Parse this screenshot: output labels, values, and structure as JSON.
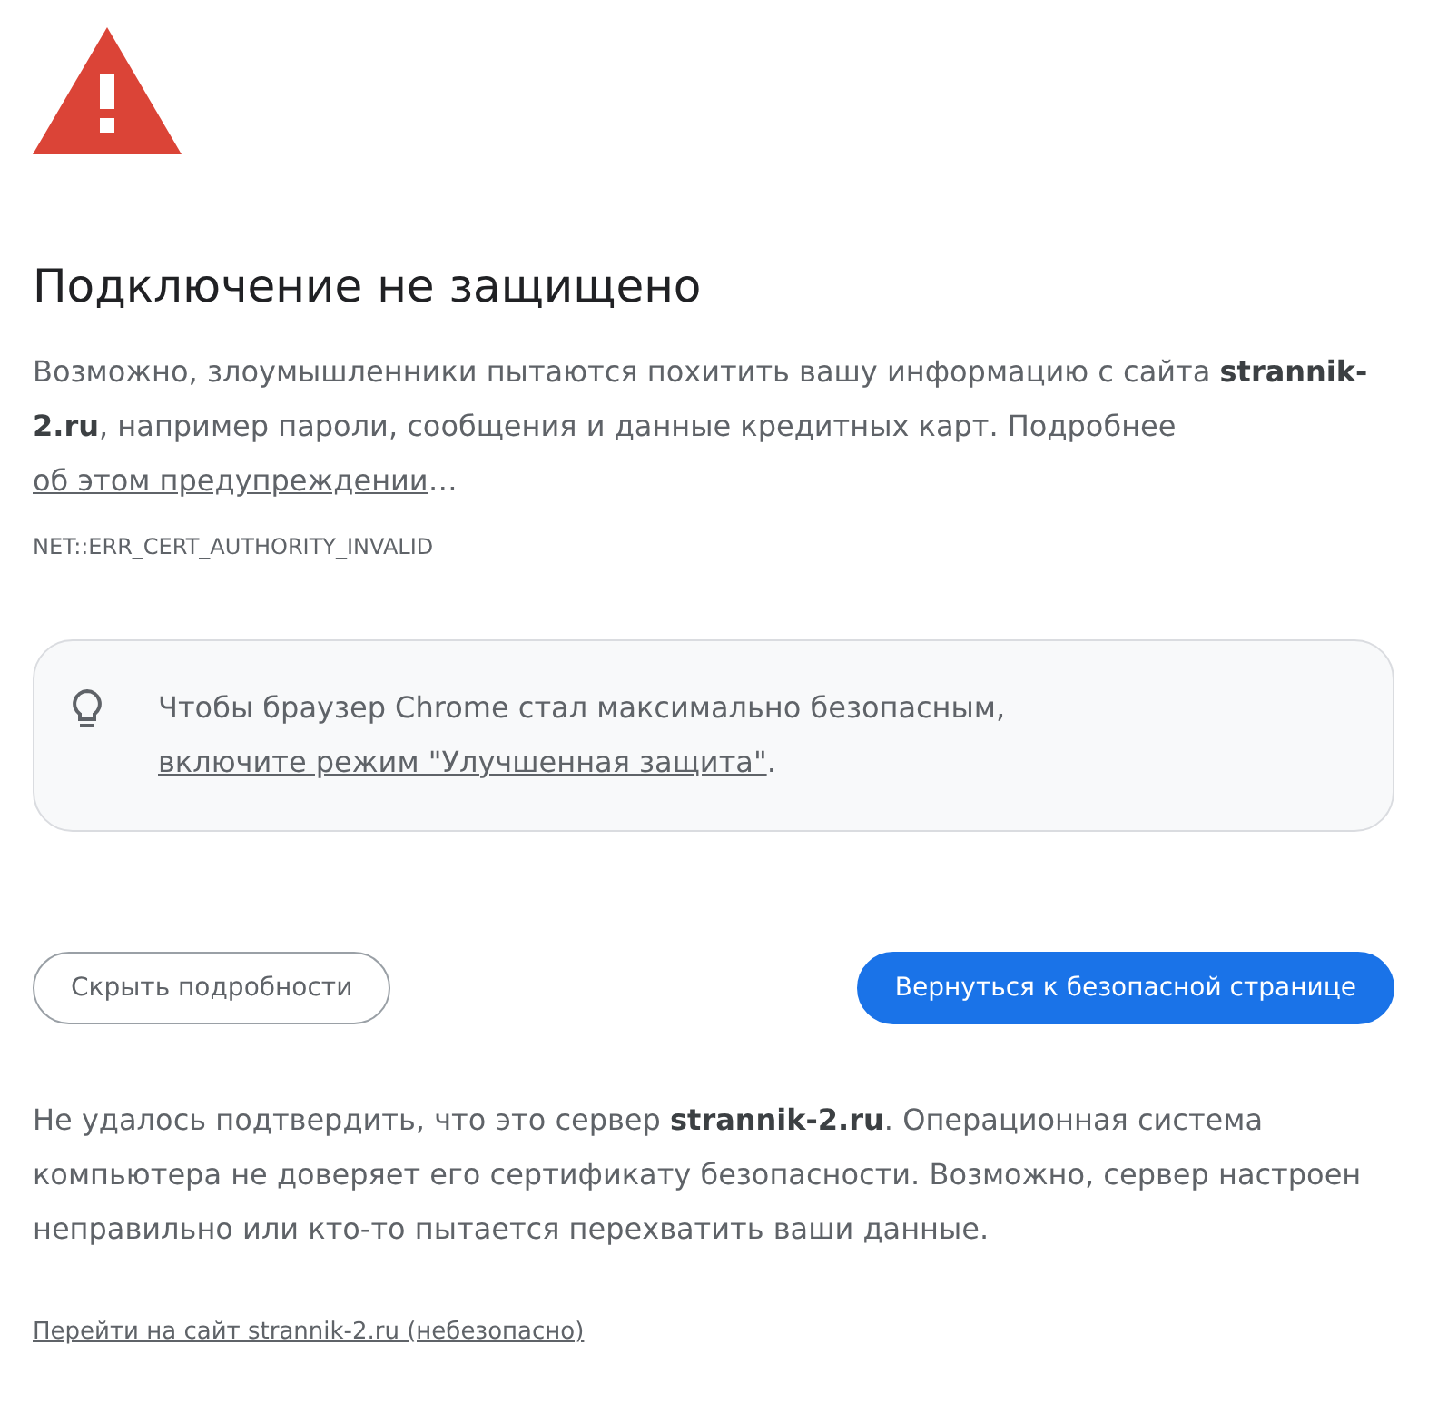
{
  "title": "Подключение не защищено",
  "intro": {
    "text": "Возможно, злоумышленники пытаются похитить вашу информацию с сайта **strannik-2.ru**, например пароли, сообщения и данные кредитных карт. Подробнее ",
    "link": "об этом предупреждении",
    "after": "…"
  },
  "error_code": "NET::ERR_CERT_AUTHORITY_INVALID",
  "tip": {
    "text": "Чтобы браузер Chrome стал максимально безопасным, ",
    "link": "включите режим \"Улучшенная защита\"",
    "after": "."
  },
  "buttons": [
    {
      "label": "Скрыть подробности",
      "kind": "secondary"
    },
    {
      "label": "Вернуться к безопасной странице",
      "kind": "primary"
    }
  ],
  "details": "Не удалось подтвердить, что это сервер **strannik-2.ru**. Операционная система компьютера не доверяет его сертификату безопасности. Возможно, сервер настроен неправильно или кто-то пытается перехватить ваши данные.",
  "proceed_link": "Перейти на сайт strannik-2.ru (небезопасно)"
}
